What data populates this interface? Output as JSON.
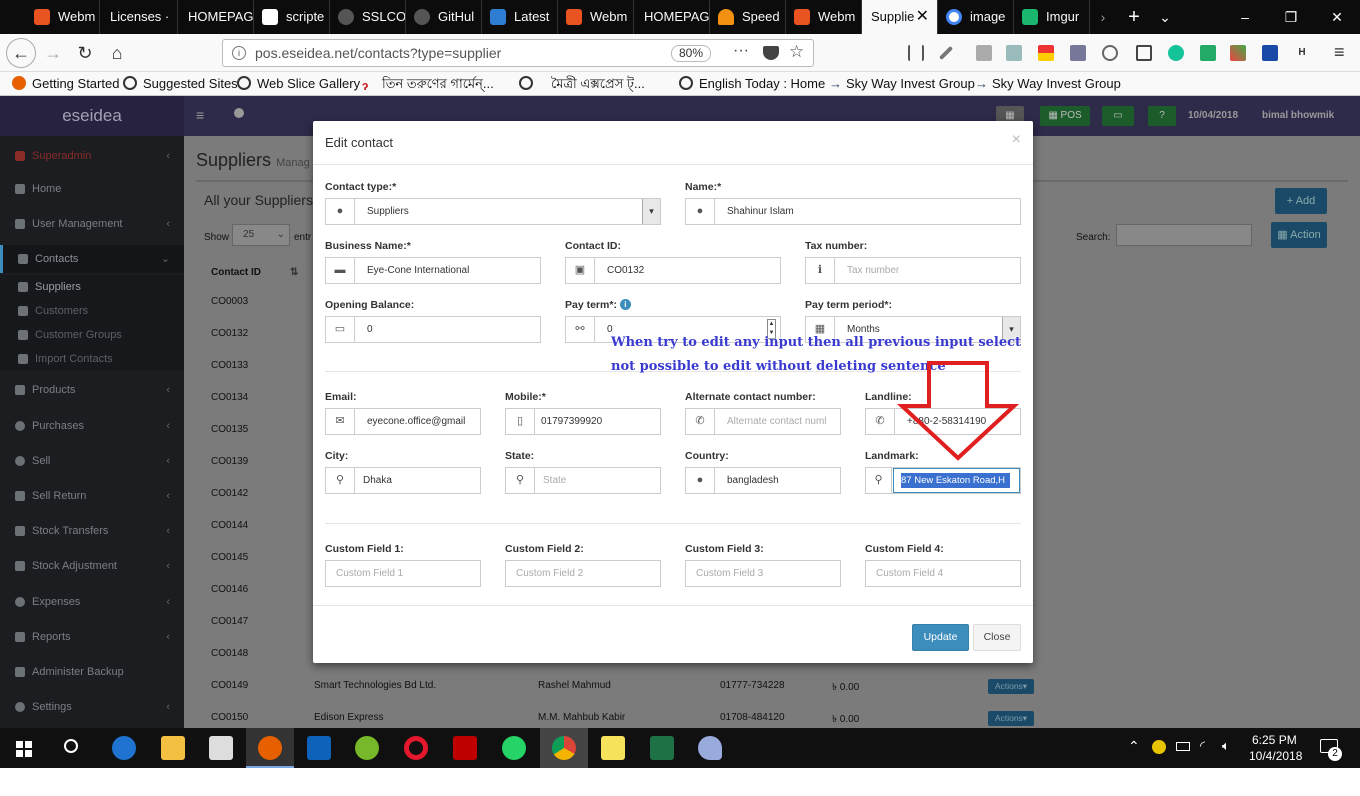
{
  "browser": {
    "tabs": [
      {
        "label": "Webm",
        "color": "#e8531f"
      },
      {
        "label": "Licenses ·",
        "color": "#1a1a1a"
      },
      {
        "label": "HOMEPAG",
        "color": "#1a1a1a"
      },
      {
        "label": "scripte",
        "color": "#ffffff"
      },
      {
        "label": "SSLCO",
        "color": "#24292e"
      },
      {
        "label": "GitHul",
        "color": "#24292e"
      },
      {
        "label": "Latest",
        "color": "#2d7dd2"
      },
      {
        "label": "Webm",
        "color": "#e8531f"
      },
      {
        "label": "HOMEPAG",
        "color": "#1a1a1a"
      },
      {
        "label": "Speed",
        "color": "#f29111"
      },
      {
        "label": "Webm",
        "color": "#e8531f"
      },
      {
        "label": "Supplie",
        "color": "#f9f9fa"
      },
      {
        "label": "image",
        "color": "#ffffff"
      },
      {
        "label": "Imgur",
        "color": "#1bb76e"
      }
    ],
    "url": "pos.eseidea.net/contacts?type=supplier",
    "zoom": "80%",
    "bookmarks": [
      "Getting Started",
      "Suggested Sites",
      "Web Slice Gallery",
      "তিন তরুণের গার্মেন্...",
      "মৈত্রী এক্সপ্রেস ট্...",
      "English Today : Home",
      "Sky Way Invest Group",
      "Sky Way Invest Group"
    ]
  },
  "app": {
    "logo": "eseidea",
    "header": {
      "pos_label": "POS",
      "date": "10/04/2018",
      "user": "bimal bhowmik"
    },
    "sidebar": [
      "Superadmin",
      "Home",
      "User Management",
      "Contacts",
      "Suppliers",
      "Customers",
      "Customer Groups",
      "Import Contacts",
      "Products",
      "Purchases",
      "Sell",
      "Sell Return",
      "Stock Transfers",
      "Stock Adjustment",
      "Expenses",
      "Reports",
      "Administer Backup",
      "Settings"
    ],
    "page_title": "Suppliers",
    "page_subtitle": "Manag",
    "box_title": "All your Suppliers",
    "add_label": "Add",
    "show_label": "Show",
    "show_value": "25",
    "entries_label": "entr",
    "search_label": "Search:",
    "action_label": "Action",
    "col_contact_id": "Contact ID",
    "contact_ids": [
      "CO0003",
      "CO0132",
      "CO0133",
      "CO0134",
      "CO0135",
      "CO0139",
      "CO0142",
      "CO0144",
      "CO0145",
      "CO0146",
      "CO0147",
      "CO0148",
      "CO0149",
      "CO0150"
    ],
    "rows_visible": [
      {
        "business": "Smart Technologies Bd Ltd.",
        "name": "Rashel Mahmud",
        "mobile": "01777-734228",
        "due": "৳ 0.00",
        "actions": "Actions"
      },
      {
        "business": "Edison Express",
        "name": "M.M. Mahbub Kabir",
        "mobile": "01708-484120",
        "due": "৳ 0.00",
        "actions": "Actions"
      }
    ]
  },
  "modal": {
    "title": "Edit contact",
    "close": "×",
    "contact_type_label": "Contact type:*",
    "contact_type_value": "Suppliers",
    "name_label": "Name:*",
    "name_value": "Shahinur Islam",
    "business_label": "Business Name:*",
    "business_value": "Eye-Cone International",
    "contact_id_label": "Contact ID:",
    "contact_id_value": "CO0132",
    "tax_label": "Tax number:",
    "tax_placeholder": "Tax number",
    "opening_label": "Opening Balance:",
    "opening_value": "0",
    "payterm_label": "Pay term*:",
    "payterm_value": "0",
    "payperiod_label": "Pay term period*:",
    "payperiod_value": "Months",
    "email_label": "Email:",
    "email_value": "eyecone.office@gmail",
    "mobile_label": "Mobile:*",
    "mobile_value": "01797399920",
    "alt_label": "Alternate contact number:",
    "alt_placeholder": "Alternate contact numl",
    "landline_label": "Landline:",
    "landline_value": "+880-2-58314190",
    "city_label": "City:",
    "city_value": "Dhaka",
    "state_label": "State:",
    "state_placeholder": "State",
    "country_label": "Country:",
    "country_value": "bangladesh",
    "landmark_label": "Landmark:",
    "landmark_value": "87 New Eskaton Road,H",
    "cf1_label": "Custom Field 1:",
    "cf1_placeholder": "Custom Field 1",
    "cf2_label": "Custom Field 2:",
    "cf2_placeholder": "Custom Field 2",
    "cf3_label": "Custom Field 3:",
    "cf3_placeholder": "Custom Field 3",
    "cf4_label": "Custom Field 4:",
    "cf4_placeholder": "Custom Field 4",
    "update_label": "Update",
    "close_label": "Close"
  },
  "annotation": {
    "line1": "When try to edit any input then all previous input select",
    "line2": "not possible to edit without deleting sentence",
    "arrow_color": "#e02020"
  },
  "taskbar": {
    "time": "6:25 PM",
    "date": "10/4/2018",
    "notifications": "2"
  }
}
